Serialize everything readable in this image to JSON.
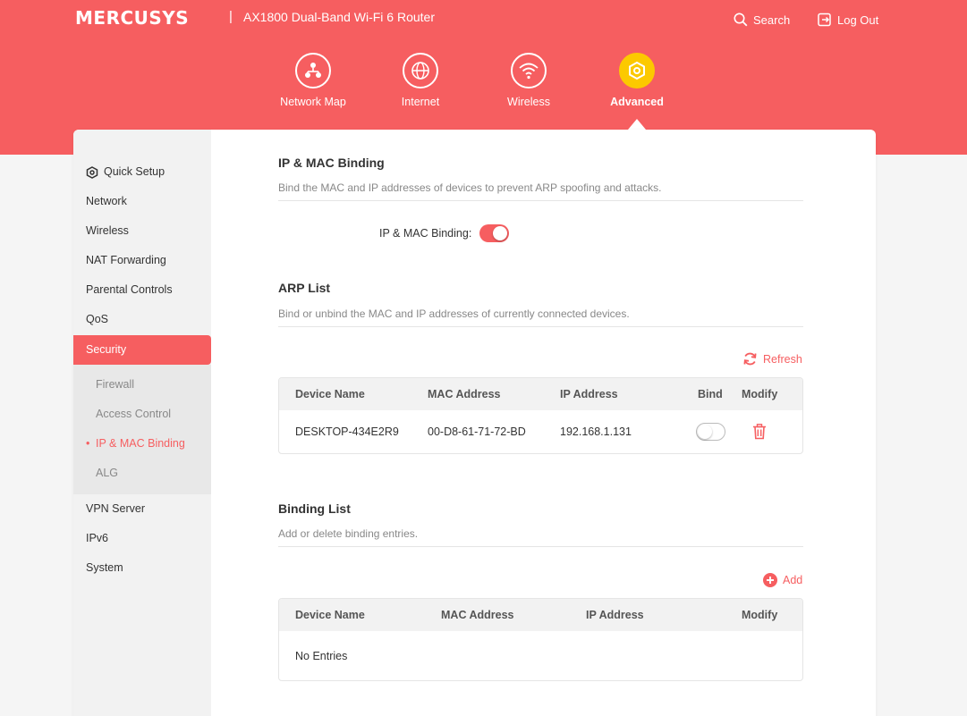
{
  "header": {
    "brand": "MERCUSYS",
    "separator": "|",
    "model": "AX1800 Dual-Band Wi-Fi 6 Router",
    "search_label": "Search",
    "logout_label": "Log Out"
  },
  "nav": {
    "items": [
      {
        "label": "Network Map",
        "icon": "network-map-icon"
      },
      {
        "label": "Internet",
        "icon": "globe-icon"
      },
      {
        "label": "Wireless",
        "icon": "wifi-icon"
      },
      {
        "label": "Advanced",
        "icon": "gear-icon",
        "active": true
      }
    ]
  },
  "sidebar": {
    "items": [
      {
        "label": "Quick Setup",
        "icon": "gear-icon"
      },
      {
        "label": "Network"
      },
      {
        "label": "Wireless"
      },
      {
        "label": "NAT Forwarding"
      },
      {
        "label": "Parental Controls"
      },
      {
        "label": "QoS"
      },
      {
        "label": "Security",
        "active": true
      },
      {
        "label": "VPN Server"
      },
      {
        "label": "IPv6"
      },
      {
        "label": "System"
      }
    ],
    "security_sub": [
      {
        "label": "Firewall"
      },
      {
        "label": "Access Control"
      },
      {
        "label": "IP & MAC Binding",
        "active": true
      },
      {
        "label": "ALG"
      }
    ]
  },
  "binding": {
    "title": "IP & MAC Binding",
    "desc": "Bind the MAC and IP addresses of devices to prevent ARP spoofing and attacks.",
    "toggle_label": "IP & MAC Binding:",
    "enabled": true
  },
  "arp": {
    "title": "ARP List",
    "desc": "Bind or unbind the MAC and IP addresses of currently connected devices.",
    "refresh_label": "Refresh",
    "columns": [
      "Device Name",
      "MAC Address",
      "IP Address",
      "Bind",
      "Modify"
    ],
    "rows": [
      {
        "device": "DESKTOP-434E2R9",
        "mac": "00-D8-61-71-72-BD",
        "ip": "192.168.1.131",
        "bound": false
      }
    ]
  },
  "binding_list": {
    "title": "Binding List",
    "desc": "Add or delete binding entries.",
    "add_label": "Add",
    "columns": [
      "Device Name",
      "MAC Address",
      "IP Address",
      "Modify"
    ],
    "empty_text": "No Entries"
  },
  "colors": {
    "accent": "#f65e60",
    "active_nav": "#fcc900"
  }
}
